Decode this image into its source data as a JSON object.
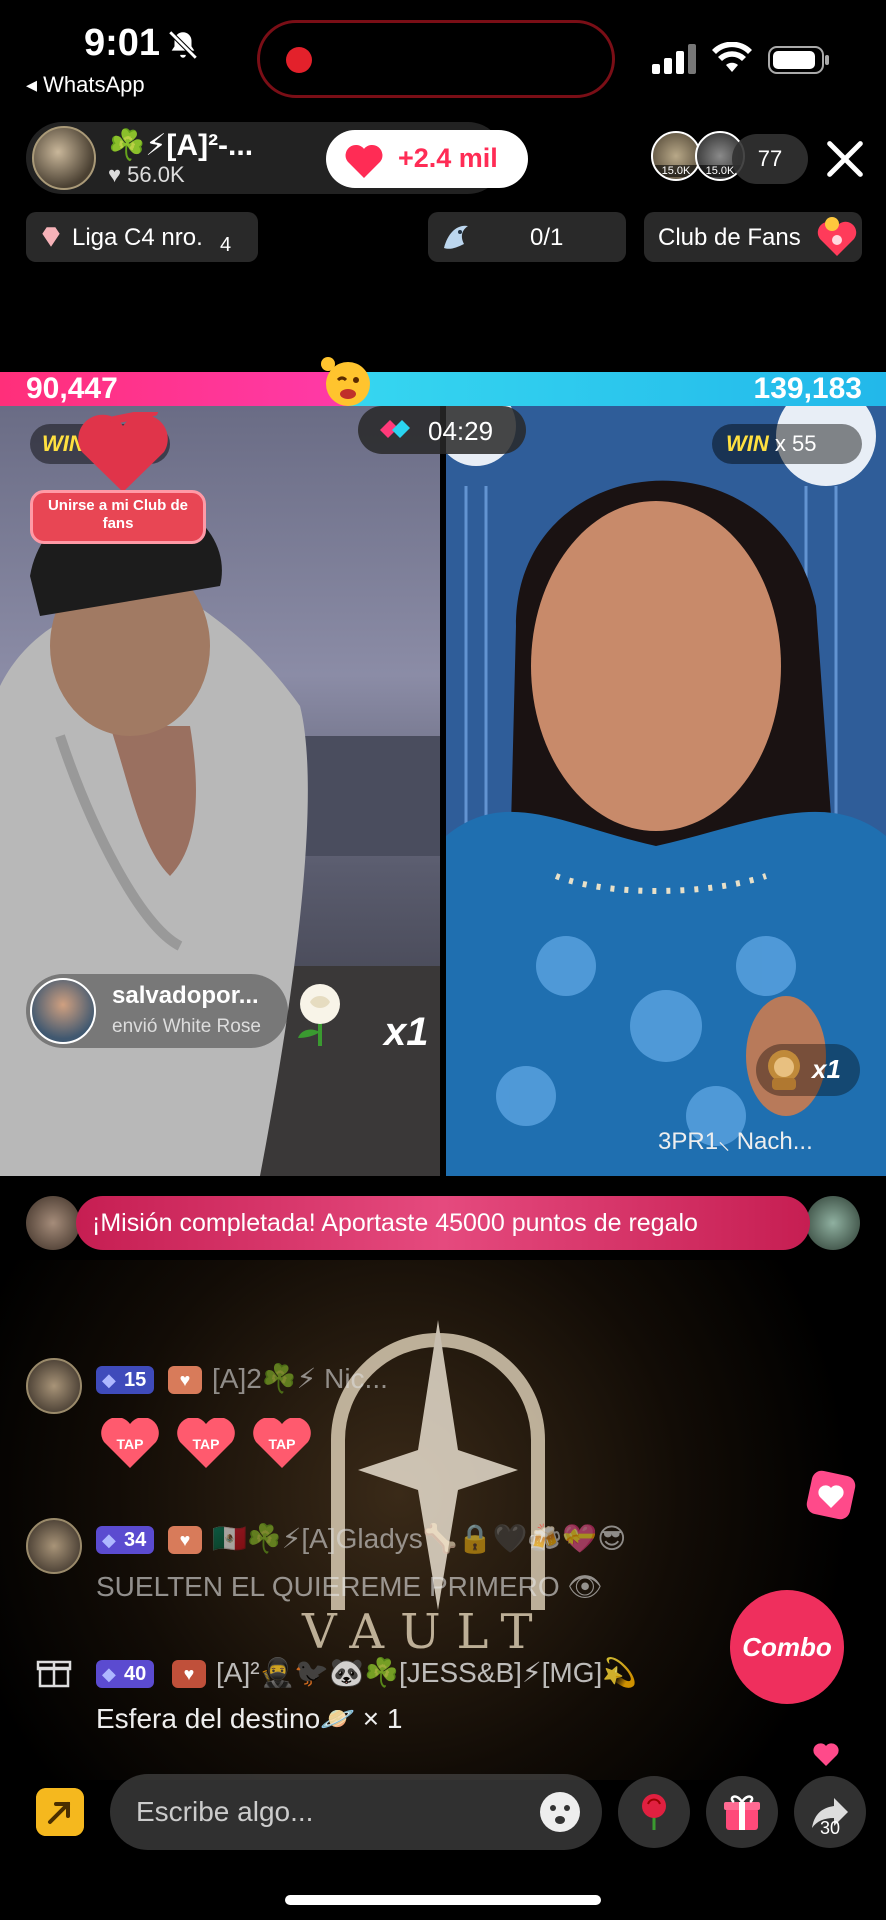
{
  "status_bar": {
    "time": "9:01",
    "back_app": "◂ WhatsApp"
  },
  "host": {
    "name": "☘️⚡[A]²-...",
    "likes": "♥ 56.0K",
    "like_button": "+2.4 mil"
  },
  "viewers": {
    "avatar1": "15.0K",
    "avatar2": "15.0K",
    "count": "77"
  },
  "league": {
    "label": "Liga C4 nro.",
    "number": "4"
  },
  "goal": {
    "label": "0/1"
  },
  "fans": {
    "label": "Club de Fans"
  },
  "battle": {
    "score_left": "90,447",
    "score_right": "139,183",
    "timer": "04:29",
    "win_word": "WIN",
    "win_left": "x 0",
    "win_right": "x 55",
    "left_ratio": 0.394,
    "colors": {
      "left": "#ff2f7a",
      "right": "#36d6f0"
    }
  },
  "clubfans_badge": {
    "text": "Unirse a mi Club de fans"
  },
  "gift_left": {
    "user": "salvadopor...",
    "desc": "envió White Rose",
    "count": "x1"
  },
  "gift_right": {
    "count": "x1",
    "names": "3PR1⸜ Nach..."
  },
  "mission": {
    "text": "¡Misión completada! Aportaste 45000 puntos de regalo"
  },
  "vault": {
    "text": "VAULT"
  },
  "chat": [
    {
      "level": "15",
      "name": "[A]2☘️⚡  Nic...",
      "message": ""
    },
    {
      "level": "34",
      "name": "🇲🇽☘️⚡[A]Gladys🦴🔒🖤🍻💝😎",
      "message": "SUELTEN EL QUIEREME PRIMERO 👁"
    },
    {
      "level": "40",
      "name": "[A]²🥷🐦‍⬛🐼☘️[JESS&B]⚡[MG]💫",
      "message": "Esfera del destino🪐 × 1"
    }
  ],
  "tap": [
    "TAP",
    "TAP",
    "TAP"
  ],
  "combo": {
    "label": "Combo"
  },
  "input": {
    "placeholder": "Escribe algo..."
  },
  "share": {
    "count": "30"
  }
}
